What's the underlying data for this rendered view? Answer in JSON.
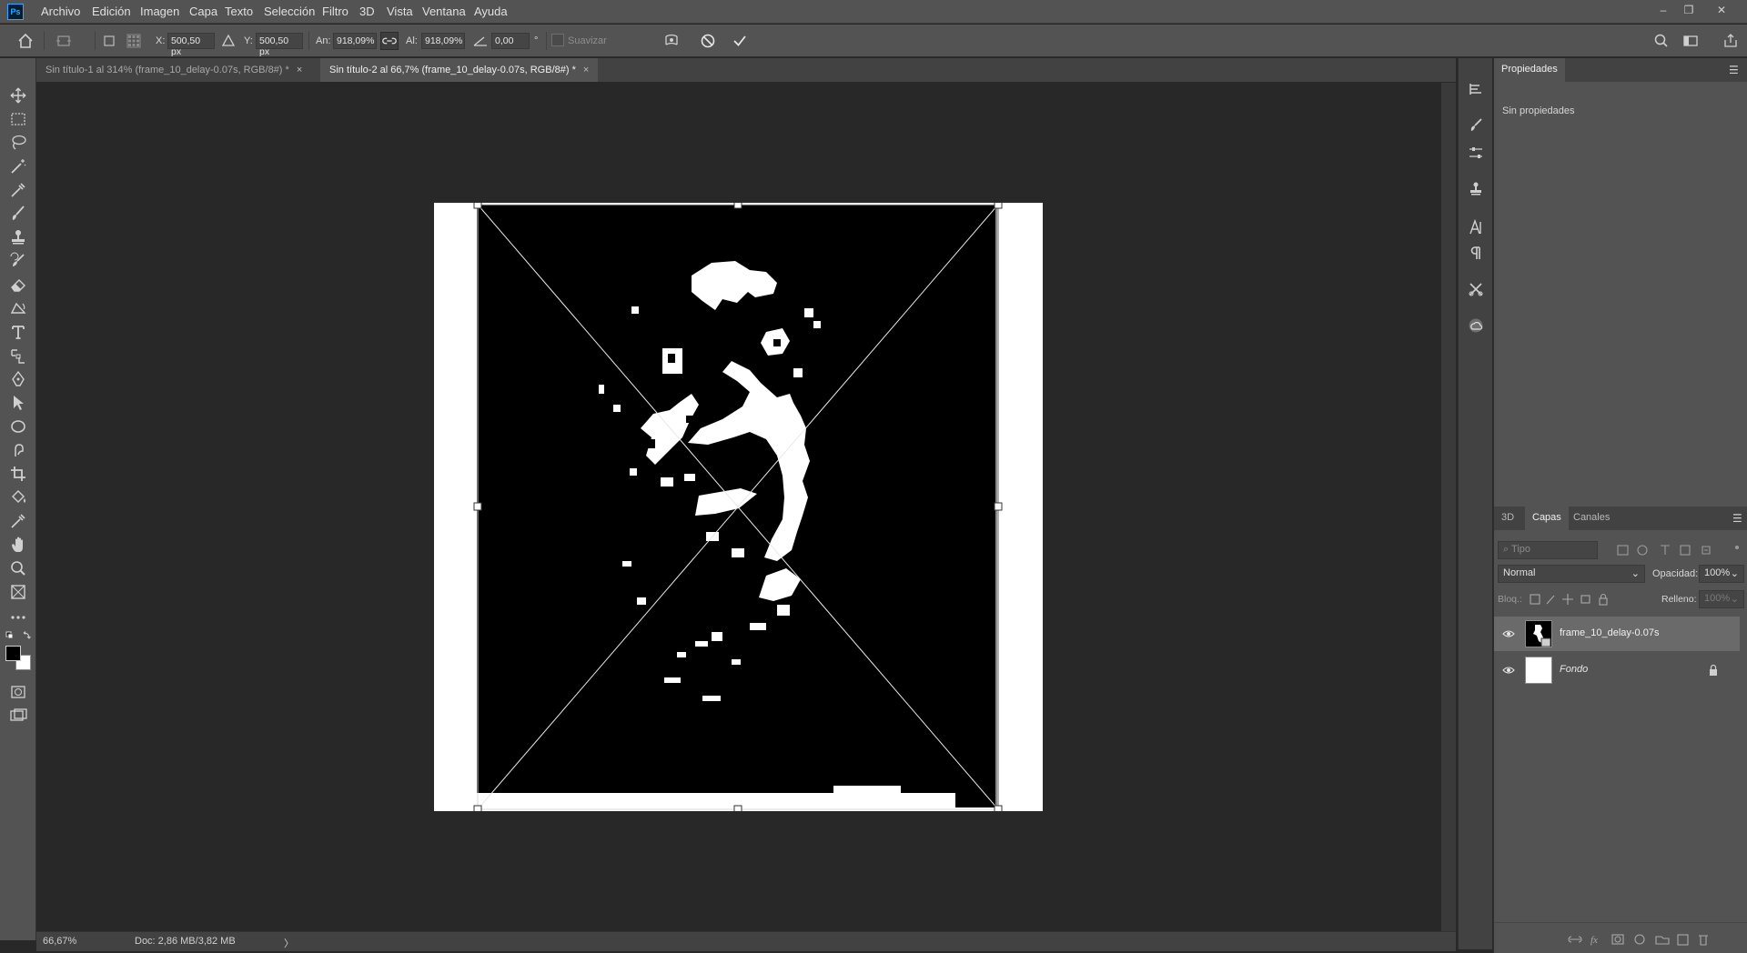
{
  "app": {
    "logo": "Ps"
  },
  "menu": [
    "Archivo",
    "Edición",
    "Imagen",
    "Capa",
    "Texto",
    "Selección",
    "Filtro",
    "3D",
    "Vista",
    "Ventana",
    "Ayuda"
  ],
  "window_controls": {
    "minimize": "–",
    "restore": "❐",
    "close": "✕"
  },
  "options": {
    "x_label": "X:",
    "x_value": "500,50 px",
    "y_label": "Y:",
    "y_value": "500,50 px",
    "w_label": "An:",
    "w_value": "918,09%",
    "h_label": "Al:",
    "h_value": "918,09%",
    "angle_value": "0,00",
    "angle_unit": "°",
    "smooth_label": "Suavizar"
  },
  "tabs": [
    {
      "label": "Sin título-1 al 314% (frame_10_delay-0.07s, RGB/8#) *",
      "close": "×"
    },
    {
      "label": "Sin título-2 al 66,7% (frame_10_delay-0.07s, RGB/8#) *",
      "close": "×"
    }
  ],
  "status": {
    "zoom": "66,67%",
    "doc": "Doc: 2,86 MB/3,82 MB",
    "arrow": "〉"
  },
  "properties": {
    "tab": "Propiedades",
    "empty": "Sin propiedades"
  },
  "layers_panel": {
    "tabs": [
      "3D",
      "Capas",
      "Canales"
    ],
    "search_placeholder": "Tipo",
    "blend_mode": "Normal",
    "opacity_label": "Opacidad:",
    "opacity_value": "100%",
    "lock_label": "Bloq.:",
    "fill_label": "Relleno:",
    "fill_value": "100%",
    "layers": [
      {
        "name": "frame_10_delay-0.07s",
        "selected": true
      },
      {
        "name": "Fondo",
        "selected": false
      }
    ]
  }
}
